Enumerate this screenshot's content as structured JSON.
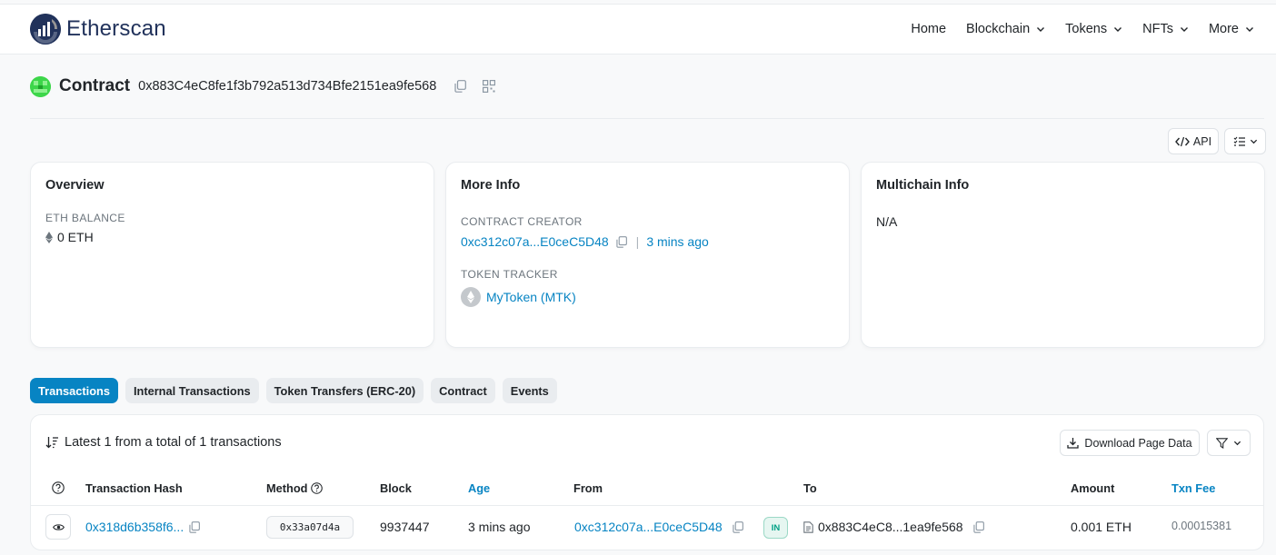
{
  "brand": {
    "name": "Etherscan"
  },
  "nav": {
    "home": "Home",
    "blockchain": "Blockchain",
    "tokens": "Tokens",
    "nfts": "NFTs",
    "more": "More"
  },
  "header": {
    "title": "Contract",
    "address": "0x883C4eC8fe1f3b792a513d734Bfe2151ea9fe568"
  },
  "toolbar": {
    "api_label": "API"
  },
  "overview": {
    "title": "Overview",
    "balance_label": "ETH BALANCE",
    "balance_value": "0 ETH"
  },
  "more_info": {
    "title": "More Info",
    "creator_label": "CONTRACT CREATOR",
    "creator_address": "0xc312c07a...E0ceC5D48",
    "creator_separator": "|",
    "creator_time": "3 mins ago",
    "tracker_label": "TOKEN TRACKER",
    "tracker_value": "MyToken (MTK)"
  },
  "multichain": {
    "title": "Multichain Info",
    "value": "N/A"
  },
  "tabs": [
    {
      "label": "Transactions",
      "active": true
    },
    {
      "label": "Internal Transactions",
      "active": false
    },
    {
      "label": "Token Transfers (ERC-20)",
      "active": false
    },
    {
      "label": "Contract",
      "active": false
    },
    {
      "label": "Events",
      "active": false
    }
  ],
  "transactions": {
    "summary": "Latest 1 from a total of 1 transactions",
    "download_label": "Download Page Data",
    "columns": {
      "hash": "Transaction Hash",
      "method": "Method",
      "block": "Block",
      "age": "Age",
      "from": "From",
      "to": "To",
      "amount": "Amount",
      "fee": "Txn Fee"
    },
    "rows": [
      {
        "hash": "0x318d6b358f6...",
        "method": "0x33a07d4a",
        "block": "9937447",
        "age": "3 mins ago",
        "from": "0xc312c07a...E0ceC5D48",
        "direction": "IN",
        "to": "0x883C4eC8...1ea9fe568",
        "amount": "0.001 ETH",
        "fee": "0.00015381"
      }
    ]
  },
  "colors": {
    "accent": "#0784c3",
    "brand": "#21325b",
    "in_badge": "#00a186"
  }
}
